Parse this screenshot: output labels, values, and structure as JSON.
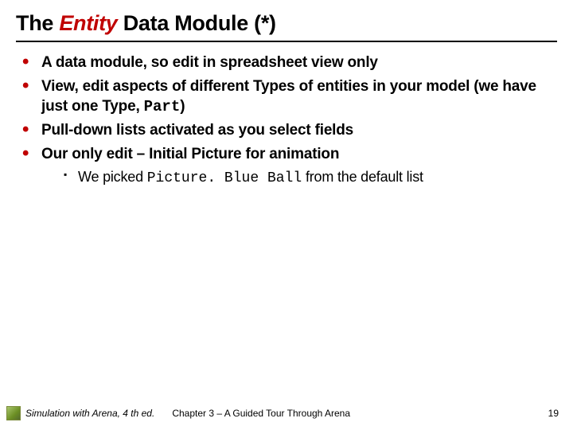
{
  "title": {
    "pre": "The ",
    "em": "Entity",
    "post": " Data Module (*)"
  },
  "bullets": [
    {
      "text": "A data module, so edit in spreadsheet view only"
    },
    {
      "pre": "View, edit aspects of different Types of entities in your model (we have just one Type, ",
      "code": "Part",
      "post": ")"
    },
    {
      "text": "Pull-down lists activated as you select fields"
    },
    {
      "text": "Our only edit – Initial Picture for animation",
      "sub": [
        {
          "pre": "We picked ",
          "code": "Picture. Blue Ball",
          "post": " from the default list"
        }
      ]
    }
  ],
  "footer": {
    "book": "Simulation with Arena, 4 th ed.",
    "chapter": "Chapter 3 – A Guided Tour Through Arena",
    "page": "19"
  }
}
